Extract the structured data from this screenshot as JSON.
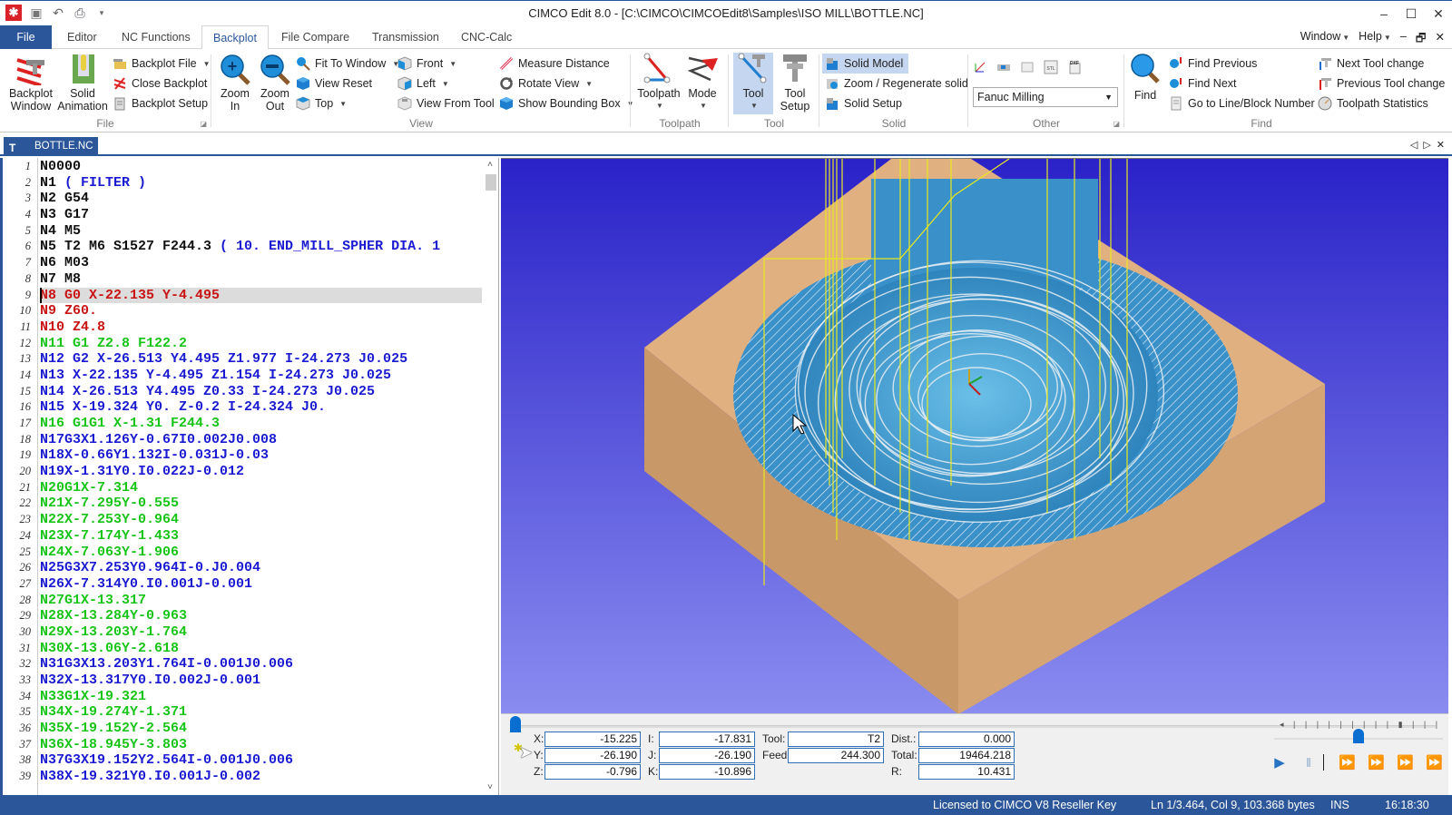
{
  "window": {
    "title": "CIMCO Edit 8.0 - [C:\\CIMCO\\CIMCOEdit8\\Samples\\ISO MILL\\BOTTLE.NC]",
    "controls": {
      "minimize": "–",
      "maximize": "☐",
      "close": "✕"
    }
  },
  "quick_access": [
    {
      "name": "app-logo-icon",
      "glyph": "✱"
    },
    {
      "name": "save-icon",
      "glyph": "💾"
    },
    {
      "name": "undo-icon",
      "glyph": "↶"
    },
    {
      "name": "print-icon",
      "glyph": "🖶"
    },
    {
      "name": "customize-icon",
      "glyph": "▾"
    }
  ],
  "tabs": [
    {
      "label": "File"
    },
    {
      "label": "Editor"
    },
    {
      "label": "NC Functions"
    },
    {
      "label": "Backplot",
      "active": true
    },
    {
      "label": "File Compare"
    },
    {
      "label": "Transmission"
    },
    {
      "label": "CNC-Calc"
    }
  ],
  "menu_right": {
    "window": "Window",
    "help": "Help",
    "mdi_min": "–",
    "mdi_restore": "🗗",
    "mdi_close": "✕"
  },
  "ribbon": {
    "file_group": {
      "label": "File",
      "backplot_window": [
        "Backplot",
        "Window"
      ],
      "solid_animation": [
        "Solid",
        "Animation"
      ],
      "backplot_file": "Backplot File",
      "close_backplot": "Close Backplot",
      "backplot_setup": "Backplot Setup"
    },
    "view_group": {
      "label": "View",
      "zoom_in": [
        "Zoom",
        "In"
      ],
      "zoom_out": [
        "Zoom",
        "Out"
      ],
      "fit_to_window": "Fit To Window",
      "view_reset": "View Reset",
      "top": "Top",
      "front": "Front",
      "left": "Left",
      "view_from_tool": "View From Tool",
      "measure_distance": "Measure Distance",
      "rotate_view": "Rotate View",
      "show_bounding_box": "Show Bounding Box"
    },
    "toolpath_group": {
      "label": "Toolpath",
      "toolpath": "Toolpath",
      "mode": "Mode"
    },
    "tool_group": {
      "label": "Tool",
      "tool": "Tool",
      "tool_setup": [
        "Tool",
        "Setup"
      ]
    },
    "solid_group": {
      "label": "Solid",
      "solid_model": "Solid Model",
      "zoom_regenerate": "Zoom / Regenerate solid",
      "solid_setup": "Solid Setup"
    },
    "other_group": {
      "label": "Other",
      "machine_select": "Fanuc Milling",
      "dxf_label": "DXF",
      "stl_label": "STL"
    },
    "find_group": {
      "label": "Find",
      "find": "Find",
      "find_previous": "Find Previous",
      "find_next": "Find Next",
      "goto_line": "Go to Line/Block Number",
      "next_tool_change": "Next Tool change",
      "previous_tool_change": "Previous Tool change",
      "toolpath_statistics": "Toolpath Statistics"
    }
  },
  "document": {
    "tab_label": "BOTTLE.NC",
    "tab_icon": "T",
    "strip_controls": {
      "prev": "◁",
      "next": "▷",
      "close": "✕"
    }
  },
  "editor": {
    "current_line": 9,
    "lines": [
      {
        "n": "1",
        "text": "N0000",
        "color": "black"
      },
      {
        "n": "2",
        "text": "N1 ",
        "comment": "( FILTER )",
        "color": "black"
      },
      {
        "n": "3",
        "text": "N2 G54",
        "color": "black"
      },
      {
        "n": "4",
        "text": "N3 G17",
        "color": "black"
      },
      {
        "n": "5",
        "text": "N4 M5",
        "color": "black"
      },
      {
        "n": "6",
        "text": "N5 T2 M6 S1527 F244.3 ",
        "comment": "( 10. END_MILL_SPHER DIA. 1",
        "color": "black"
      },
      {
        "n": "7",
        "text": "N6 M03",
        "color": "black"
      },
      {
        "n": "8",
        "text": "N7 M8",
        "color": "black"
      },
      {
        "n": "9",
        "text": "N8 G0 X-22.135 Y-4.495",
        "color": "red"
      },
      {
        "n": "10",
        "text": "N9 Z60.",
        "color": "red"
      },
      {
        "n": "11",
        "text": "N10 Z4.8",
        "color": "red"
      },
      {
        "n": "12",
        "text": "N11 G1 Z2.8 F122.2",
        "color": "green"
      },
      {
        "n": "13",
        "text": "N12 G2 X-26.513 Y4.495 Z1.977 I-24.273 J0.025",
        "color": "blue"
      },
      {
        "n": "14",
        "text": "N13 X-22.135 Y-4.495 Z1.154 I-24.273 J0.025",
        "color": "blue"
      },
      {
        "n": "15",
        "text": "N14 X-26.513 Y4.495 Z0.33 I-24.273 J0.025",
        "color": "blue"
      },
      {
        "n": "16",
        "text": "N15 X-19.324 Y0. Z-0.2 I-24.324 J0.",
        "color": "blue"
      },
      {
        "n": "17",
        "text": "N16 G1G1 X-1.31 F244.3",
        "color": "green"
      },
      {
        "n": "18",
        "text": "N17G3X1.126Y-0.67I0.002J0.008",
        "color": "blue"
      },
      {
        "n": "19",
        "text": "N18X-0.66Y1.132I-0.031J-0.03",
        "color": "blue"
      },
      {
        "n": "20",
        "text": "N19X-1.31Y0.I0.022J-0.012",
        "color": "blue"
      },
      {
        "n": "21",
        "text": "N20G1X-7.314",
        "color": "green"
      },
      {
        "n": "22",
        "text": "N21X-7.295Y-0.555",
        "color": "green"
      },
      {
        "n": "23",
        "text": "N22X-7.253Y-0.964",
        "color": "green"
      },
      {
        "n": "24",
        "text": "N23X-7.174Y-1.433",
        "color": "green"
      },
      {
        "n": "25",
        "text": "N24X-7.063Y-1.906",
        "color": "green"
      },
      {
        "n": "26",
        "text": "N25G3X7.253Y0.964I-0.J0.004",
        "color": "blue"
      },
      {
        "n": "27",
        "text": "N26X-7.314Y0.I0.001J-0.001",
        "color": "blue"
      },
      {
        "n": "28",
        "text": "N27G1X-13.317",
        "color": "green"
      },
      {
        "n": "29",
        "text": "N28X-13.284Y-0.963",
        "color": "green"
      },
      {
        "n": "30",
        "text": "N29X-13.203Y-1.764",
        "color": "green"
      },
      {
        "n": "31",
        "text": "N30X-13.06Y-2.618",
        "color": "green"
      },
      {
        "n": "32",
        "text": "N31G3X13.203Y1.764I-0.001J0.006",
        "color": "blue"
      },
      {
        "n": "33",
        "text": "N32X-13.317Y0.I0.002J-0.001",
        "color": "blue"
      },
      {
        "n": "34",
        "text": "N33G1X-19.321",
        "color": "green"
      },
      {
        "n": "35",
        "text": "N34X-19.274Y-1.371",
        "color": "green"
      },
      {
        "n": "36",
        "text": "N35X-19.152Y-2.564",
        "color": "green"
      },
      {
        "n": "37",
        "text": "N36X-18.945Y-3.803",
        "color": "green"
      },
      {
        "n": "38",
        "text": "N37G3X19.152Y2.564I-0.001J0.006",
        "color": "blue"
      },
      {
        "n": "39",
        "text": "N38X-19.321Y0.I0.001J-0.002",
        "color": "blue"
      }
    ],
    "scroll_up": "˄",
    "scroll_down": "˅"
  },
  "viewport": {
    "background_top": "#2a22c8",
    "background_bottom": "#8a8cf0",
    "stock_top_color": "#e0b080",
    "stock_side_color": "#c89868",
    "part_color": "#3a90c8",
    "rapid_color": "#e8e820",
    "feed_color": "#e8eef4"
  },
  "simulation": {
    "position_progress": 0.0,
    "fields": {
      "x": {
        "label": "X:",
        "value": "-15.225"
      },
      "y": {
        "label": "Y:",
        "value": "-26.190"
      },
      "z": {
        "label": "Z:",
        "value": "-0.796"
      },
      "i": {
        "label": "I:",
        "value": "-17.831"
      },
      "j": {
        "label": "J:",
        "value": "-26.190"
      },
      "k": {
        "label": "K:",
        "value": "-10.896"
      },
      "tool": {
        "label": "Tool:",
        "value": "T2"
      },
      "feed": {
        "label": "Feed:",
        "value": "244.300"
      },
      "dist": {
        "label": "Dist.:",
        "value": "0.000"
      },
      "total": {
        "label": "Total:",
        "value": "19464.218"
      },
      "r": {
        "label": "R:",
        "value": "10.431"
      }
    },
    "speed_fraction": 0.5,
    "controls": {
      "play": "▶",
      "pause": "‖",
      "step_point": "⏩",
      "step_tool": "⏩",
      "step_z": "⏩",
      "step_toolchange": "⏩"
    }
  },
  "statusbar": {
    "license": "Licensed to CIMCO V8 Reseller Key",
    "position": "Ln 1/3.464, Col 9, 103.368 bytes",
    "mode": "INS",
    "time": "16:18:30"
  }
}
